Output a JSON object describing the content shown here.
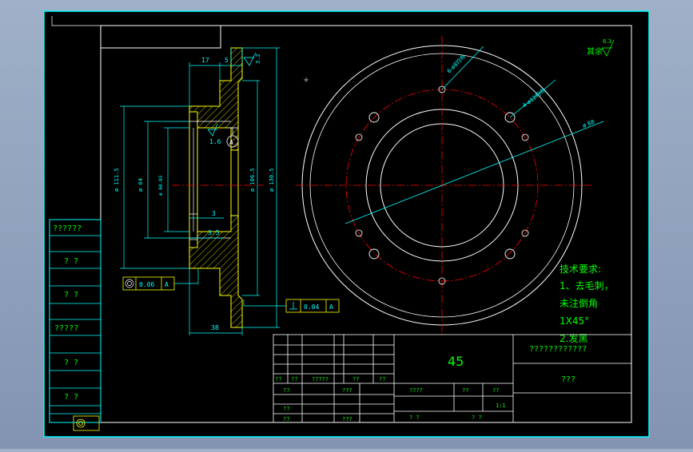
{
  "colors": {
    "background_outer": "#8fa1bf",
    "sheet": "#000000",
    "border": "#00ffff",
    "white_line": "#ffffff",
    "yellow_line": "#ffff00",
    "red_line": "#ff0000",
    "green_text": "#00ff00",
    "cyan_dim": "#00ffff"
  },
  "dimensions": {
    "top_17": "17",
    "top_5": "5",
    "roughness_top": "3.2",
    "roughness_mid": "1.6",
    "datum_A_mid": "A",
    "dia_left_outer": "ø 111.5",
    "dia_left_inner": "ø 64",
    "dia_left_bore": "ø 60.03",
    "dia_right_1": "ø 106.5",
    "dia_right_2": "ø 130.5",
    "dim_3": "3",
    "dim_3_5": "3.5",
    "dim_bottom_38": "38",
    "hole_callout_1": "6-ø8均布",
    "hole_callout_2": "4-ø12均布",
    "dia_circle": "ø 88",
    "roughness_rest_label": "其余",
    "roughness_rest_value": "6.3"
  },
  "tolerances": {
    "concentricity_value": "0.06",
    "concentricity_datum": "A",
    "perpendicular_value": "0.04",
    "perpendicular_datum": "A"
  },
  "tech_req": {
    "title": "技术要求:",
    "line1": "1、去毛刺，",
    "line2": "未注倒角",
    "line3": "1X45°",
    "line4": "2.发黑"
  },
  "title_block": {
    "material": "45",
    "drawing_name": "????????????",
    "drawing_code": "???",
    "row_labels": [
      "??",
      "??",
      "?????",
      "??",
      "??"
    ],
    "sign_1": "??",
    "sign_2": "???",
    "sign_3": "??",
    "sign_4": "??",
    "sign_5": "???",
    "stage_label": "????",
    "weight_label": "??",
    "scale_label": "??",
    "scale_value": "1:1",
    "sheet_1": "? ?",
    "sheet_2": "? ?"
  },
  "left_strip": {
    "labels": [
      "??????",
      "? ?",
      "? ?",
      "?????",
      "? ?",
      "? ?"
    ]
  }
}
